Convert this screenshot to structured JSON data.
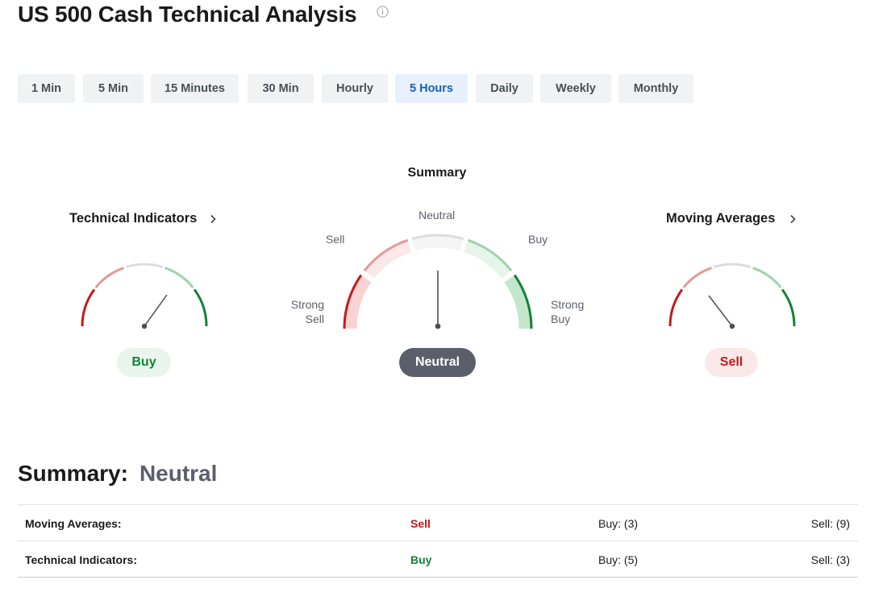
{
  "page": {
    "title": "US 500 Cash Technical Analysis",
    "info_icon": "info-circle-icon"
  },
  "timeframes": {
    "selected": "5 Hours",
    "items": [
      "1 Min",
      "5 Min",
      "15 Minutes",
      "30 Min",
      "Hourly",
      "5 Hours",
      "Daily",
      "Weekly",
      "Monthly"
    ]
  },
  "gauges": {
    "summary_title": "Summary",
    "technical_indicators": {
      "title": "Technical Indicators",
      "signal": "Buy",
      "link_icon": "chevron-right-icon"
    },
    "summary": {
      "signal": "Neutral",
      "scale_labels": {
        "strong_sell_1": "Strong",
        "strong_sell_2": "Sell",
        "sell": "Sell",
        "neutral": "Neutral",
        "buy": "Buy",
        "strong_buy_1": "Strong",
        "strong_buy_2": "Buy"
      }
    },
    "moving_averages": {
      "title": "Moving Averages",
      "signal": "Sell",
      "link_icon": "chevron-right-icon"
    }
  },
  "summary_section": {
    "label": "Summary:",
    "value": "Neutral",
    "rows": [
      {
        "name": "Moving Averages:",
        "signal": "Sell",
        "buy": "Buy: (3)",
        "sell": "Sell: (9)"
      },
      {
        "name": "Technical Indicators:",
        "signal": "Buy",
        "buy": "Buy: (5)",
        "sell": "Sell: (3)"
      }
    ]
  },
  "colors": {
    "strong_sell": "#c41a1a",
    "sell": "#e39a9a",
    "neutral": "#dcdde0",
    "buy": "#9fd3ad",
    "strong_buy": "#138237",
    "active_tab_bg": "#e8f0fb",
    "active_tab_text": "#1a5fb4",
    "needle": "#4a4f5a"
  }
}
